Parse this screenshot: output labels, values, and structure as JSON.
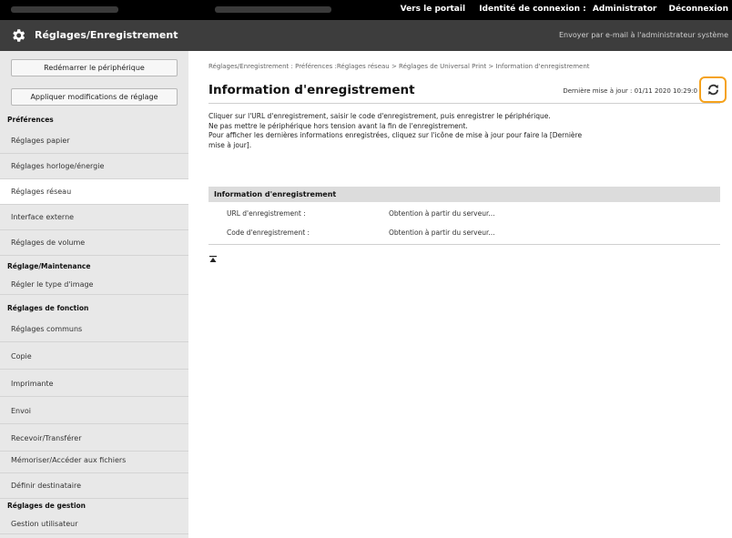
{
  "topbar": {
    "portal_link": "Vers le portail",
    "login_label": "Identité de connexion :",
    "login_user": "Administrator",
    "logout_link": "Déconnexion"
  },
  "header": {
    "title": "Réglages/Enregistrement",
    "email_link": "Envoyer par e-mail à l'administrateur système"
  },
  "sidebar": {
    "restart_button": "Redémarrer le périphérique",
    "apply_button": "Appliquer modifications de réglage",
    "sections": [
      {
        "title": "Préférences",
        "items": [
          "Réglages papier",
          "Réglages horloge/énergie",
          "Réglages réseau",
          "Interface externe",
          "Réglages de volume"
        ]
      },
      {
        "title": "Réglage/Maintenance",
        "items": [
          "Régler le type d'image"
        ]
      },
      {
        "title": "Réglages de fonction",
        "items": [
          "Réglages communs",
          "Copie",
          "Imprimante",
          "Envoi",
          "Recevoir/Transférer",
          "Mémoriser/Accéder aux fichiers",
          "Définir destinataire"
        ]
      },
      {
        "title": "Réglages de gestion",
        "items": [
          "Gestion utilisateur"
        ]
      }
    ],
    "active_item": "Réglages réseau"
  },
  "main": {
    "breadcrumb": "Réglages/Enregistrement : Préférences :Réglages réseau > Réglages de Universal Print > Information d'enregistrement",
    "title": "Information d'enregistrement",
    "last_update": "Dernière mise à jour : 01/11 2020 10:29:0",
    "description": [
      "Cliquer sur l'URL d'enregistrement, saisir le code d'enregistrement, puis enregistrer le périphérique.",
      "Ne pas mettre le périphérique hors tension avant la fin de l'enregistrement.",
      "Pour afficher les dernières informations enregistrées, cliquez sur l'icône de mise à jour pour faire la [Dernière mise à jour]."
    ],
    "info_header": "Information d'enregistrement",
    "rows": [
      {
        "label": "URL d'enregistrement :",
        "value": "Obtention à partir du serveur..."
      },
      {
        "label": "Code d'enregistrement :",
        "value": "Obtention à partir du serveur..."
      }
    ]
  },
  "colors": {
    "topbar": "#000000",
    "header": "#3d3d3d",
    "sidebar": "#e8e8e8",
    "highlight": "#f5a21c"
  },
  "icons": {
    "header": "gear-icon",
    "refresh": "refresh-icon",
    "top": "back-to-top-icon"
  }
}
